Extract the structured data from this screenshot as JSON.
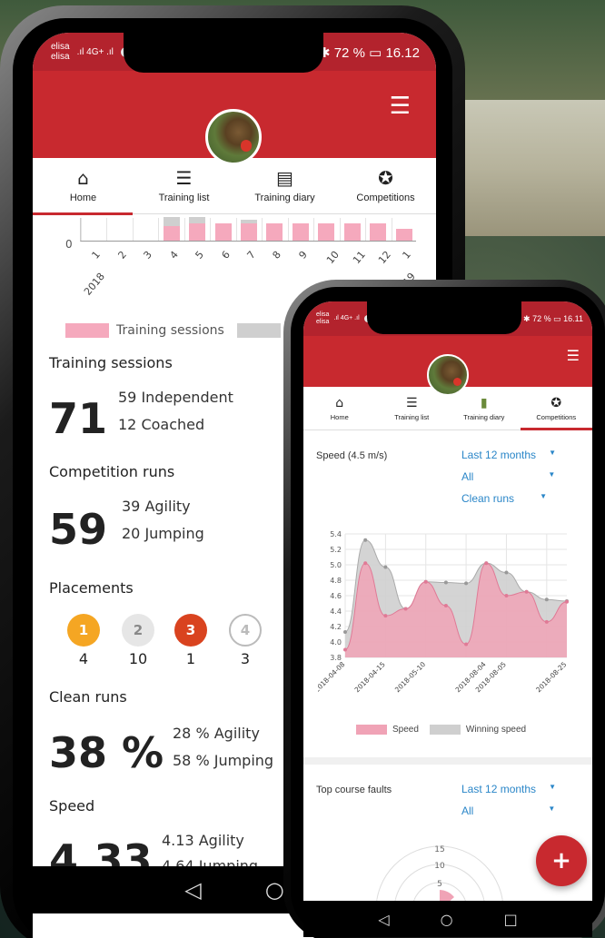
{
  "phone1": {
    "status": {
      "carrier": "elisa",
      "carrier2": "elisa",
      "signal": "4G+",
      "sim_badge": "2",
      "battery": "72 %",
      "time": "16.12"
    },
    "tabs": [
      {
        "label": "Home",
        "icon": "home-icon"
      },
      {
        "label": "Training list",
        "icon": "list-icon"
      },
      {
        "label": "Training diary",
        "icon": "notebook-icon"
      },
      {
        "label": "Competitions",
        "icon": "award-icon"
      }
    ],
    "bar_chart": {
      "chart_data": {
        "type": "bar",
        "categories": [
          "1 2018",
          "2",
          "3",
          "4",
          "5",
          "6",
          "7",
          "8",
          "9",
          "10",
          "11",
          "12",
          "1 2019"
        ],
        "series": [
          {
            "name": "Training sessions",
            "values": [
              0,
              0,
              0,
              5,
              6,
              6,
              6,
              6,
              6,
              6,
              6,
              6,
              4
            ]
          },
          {
            "name": "",
            "values": [
              0,
              0,
              0,
              3,
              2,
              0,
              1,
              0,
              0,
              0,
              0,
              0,
              0
            ]
          }
        ],
        "y_zero_label": "0",
        "tick_labels": [
          "1",
          "2",
          "3",
          "4",
          "5",
          "6",
          "7",
          "8",
          "9",
          "10",
          "11",
          "12",
          "1"
        ],
        "year_labels": [
          "2018",
          "2019"
        ]
      }
    },
    "legend": {
      "training_sessions": "Training sessions"
    },
    "training_sessions": {
      "title": "Training sessions",
      "total": "71",
      "independent": "59 Independent",
      "coached": "12 Coached"
    },
    "competition_runs": {
      "title": "Competition runs",
      "total": "59",
      "agility": "39 Agility",
      "jumping": "20 Jumping"
    },
    "placements": {
      "title": "Placements",
      "items": [
        {
          "place": "1",
          "count": "4",
          "color": "#f5a623"
        },
        {
          "place": "2",
          "count": "10",
          "color": "#e6e6e6"
        },
        {
          "place": "3",
          "count": "1",
          "color": "#d9431f"
        },
        {
          "place": "4",
          "count": "3",
          "color": "#ffffff"
        }
      ]
    },
    "clean_runs": {
      "title": "Clean runs",
      "total": "38 %",
      "agility": "28 % Agility",
      "jumping": "58 % Jumping"
    },
    "speed": {
      "title": "Speed",
      "total": "4.33",
      "agility": "4.13 Agility",
      "jumping": "4.64 Jumping"
    }
  },
  "phone2": {
    "status": {
      "carrier": "elisa",
      "carrier2": "elisa",
      "signal": "4G+",
      "sim_badge": "2",
      "battery": "72 %",
      "time": "16.11"
    },
    "tabs": [
      {
        "label": "Home",
        "icon": "home-icon"
      },
      {
        "label": "Training list",
        "icon": "list-icon"
      },
      {
        "label": "Training diary",
        "icon": "notebook-icon"
      },
      {
        "label": "Competitions",
        "icon": "award-icon"
      }
    ],
    "speed_card": {
      "title": "Speed (4.5 m/s)",
      "filters": [
        "Last 12 months",
        "All",
        "Clean runs"
      ]
    },
    "chart_data": {
      "type": "area",
      "x": [
        "2018-04-08",
        "2018-04-11",
        "2018-04-15",
        "2018-04-22",
        "2018-04-29",
        "2018-05-10",
        "2018-06-03",
        "2018-08-04",
        "2018-08-05",
        "2018-08-10",
        "2018-08-12",
        "2018-08-19",
        "2018-08-25"
      ],
      "x_tick_labels": [
        "2018-04-08",
        "2018-04-15",
        "2018-05-10",
        "2018-08-04",
        "2018-08-05",
        "2018-08-25"
      ],
      "series": [
        {
          "name": "Speed",
          "values": [
            3.9,
            5.02,
            4.34,
            4.43,
            4.78,
            4.47,
            3.97,
            5.02,
            4.6,
            4.65,
            4.26,
            4.52
          ]
        },
        {
          "name": "Winning speed",
          "values": [
            4.13,
            5.32,
            4.97,
            4.43,
            4.78,
            4.77,
            4.76,
            5.02,
            4.9,
            4.65,
            4.55,
            4.53
          ]
        }
      ],
      "y_ticks": [
        "3.8",
        "4.0",
        "4.2",
        "4.4",
        "4.6",
        "4.8",
        "5.0",
        "5.2",
        "5.4"
      ],
      "ylim": [
        3.8,
        5.4
      ],
      "colors": {
        "Speed": "#f0a3b6",
        "Winning speed": "#cfcfcf"
      }
    },
    "faults_card": {
      "title": "Top course faults",
      "filters": [
        "Last 12 months",
        "All"
      ],
      "radar_ticks": [
        "15",
        "10",
        "5"
      ]
    },
    "fab_label": "+"
  },
  "nav": {
    "back": "◁",
    "home": "○",
    "recent": "□"
  }
}
